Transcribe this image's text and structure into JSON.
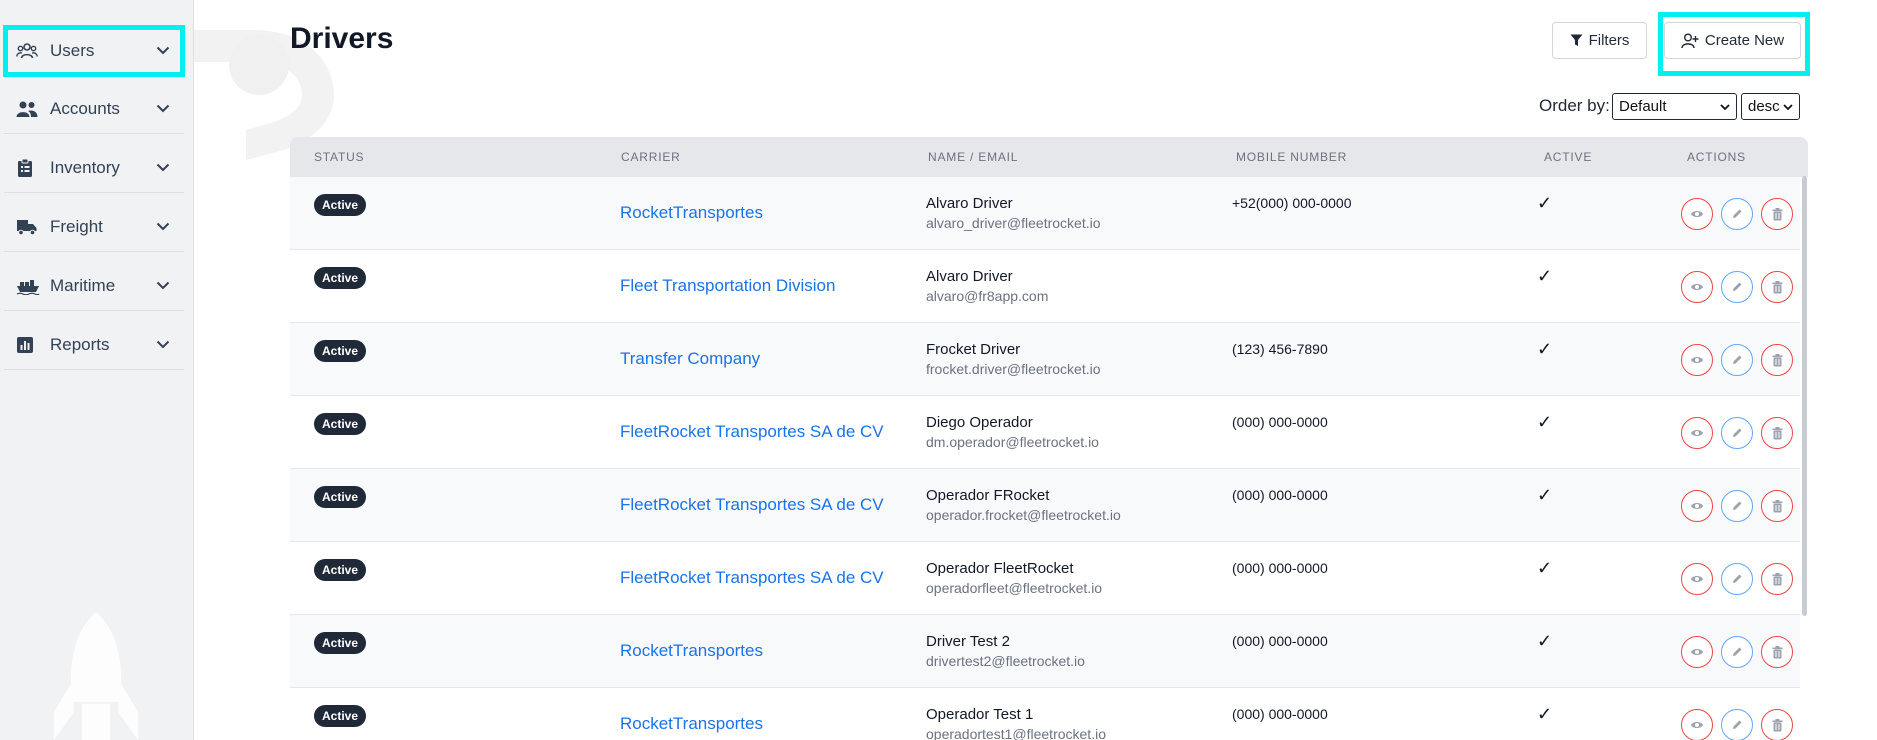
{
  "sidebar": {
    "items": [
      {
        "label": "Users",
        "icon": "users-icon"
      },
      {
        "label": "Accounts",
        "icon": "accounts-icon"
      },
      {
        "label": "Inventory",
        "icon": "clipboard-icon"
      },
      {
        "label": "Freight",
        "icon": "truck-icon"
      },
      {
        "label": "Maritime",
        "icon": "ship-icon"
      },
      {
        "label": "Reports",
        "icon": "chart-icon"
      }
    ]
  },
  "header": {
    "title": "Drivers",
    "filters_label": "Filters",
    "create_label": "Create New"
  },
  "order": {
    "label": "Order by:",
    "field_value": "Default",
    "direction_value": "desc"
  },
  "table": {
    "columns": [
      "STATUS",
      "CARRIER",
      "NAME / EMAIL",
      "MOBILE NUMBER",
      "ACTIVE",
      "ACTIONS"
    ],
    "rows": [
      {
        "status": "Active",
        "carrier": "RocketTransportes",
        "name": "Alvaro Driver",
        "email": "alvaro_driver@fleetrocket.io",
        "mobile": "+52(000) 000-0000",
        "active": "✓"
      },
      {
        "status": "Active",
        "carrier": "Fleet Transportation Division",
        "name": "Alvaro Driver",
        "email": "alvaro@fr8app.com",
        "mobile": "",
        "active": "✓"
      },
      {
        "status": "Active",
        "carrier": "Transfer Company",
        "name": "Frocket Driver",
        "email": "frocket.driver@fleetrocket.io",
        "mobile": "(123) 456-7890",
        "active": "✓"
      },
      {
        "status": "Active",
        "carrier": "FleetRocket Transportes SA de CV",
        "name": "Diego Operador",
        "email": "dm.operador@fleetrocket.io",
        "mobile": "(000) 000-0000",
        "active": "✓"
      },
      {
        "status": "Active",
        "carrier": "FleetRocket Transportes SA de CV",
        "name": "Operador FRocket",
        "email": "operador.frocket@fleetrocket.io",
        "mobile": "(000) 000-0000",
        "active": "✓"
      },
      {
        "status": "Active",
        "carrier": "FleetRocket Transportes SA de CV",
        "name": "Operador FleetRocket",
        "email": "operadorfleet@fleetrocket.io",
        "mobile": "(000) 000-0000",
        "active": "✓"
      },
      {
        "status": "Active",
        "carrier": "RocketTransportes",
        "name": "Driver Test 2",
        "email": "drivertest2@fleetrocket.io",
        "mobile": "(000) 000-0000",
        "active": "✓"
      },
      {
        "status": "Active",
        "carrier": "RocketTransportes",
        "name": "Operador Test 1",
        "email": "operadortest1@fleetrocket.io",
        "mobile": "(000) 000-0000",
        "active": "✓"
      }
    ]
  },
  "colors": {
    "link": "#1a73e8",
    "badge": "#1f2937",
    "highlight": "#00f0f0",
    "danger": "#ef4444",
    "edit": "#60a5fa"
  }
}
